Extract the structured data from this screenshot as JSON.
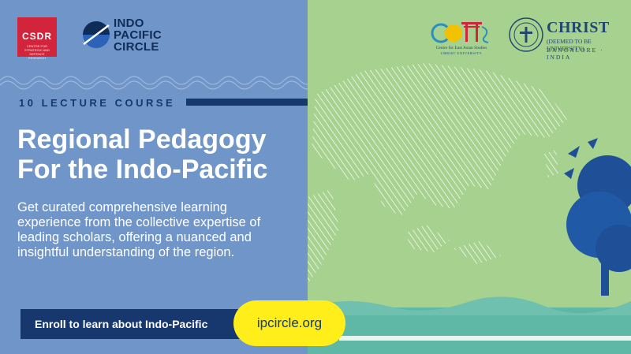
{
  "logos": {
    "csdr": {
      "text": "CSDR",
      "subtext": "CENTRE FOR STRATEGIC AND DEFENCE RESEARCH"
    },
    "ipc": {
      "line1": "INDO",
      "line2": "PACIFIC",
      "line3": "CIRCLE"
    },
    "ceas": {
      "line1": "Centre for East Asian Studies",
      "line2": "CHRIST UNIVERSITY"
    },
    "christ": {
      "name": "CHRIST",
      "deemed": "(DEEMED TO BE UNIVERSITY)",
      "city": "BANGALORE · INDIA"
    }
  },
  "course": {
    "label": "10 LECTURE COURSE"
  },
  "headline": {
    "line1": "Regional Pedagogy",
    "line2": "For the Indo-Pacific"
  },
  "description": "Get curated comprehensive learning experience from the collective expertise of leading scholars, offering a nuanced and insightful understanding of the region.",
  "cta": {
    "label": "Enroll to learn about Indo-Pacific",
    "url": "ipcircle.org"
  },
  "colors": {
    "left_bg": "#6f95c9",
    "right_bg": "#a6d18f",
    "navy": "#17386e",
    "accent_yellow": "#ffee1a",
    "csdr_red": "#d2243a"
  }
}
